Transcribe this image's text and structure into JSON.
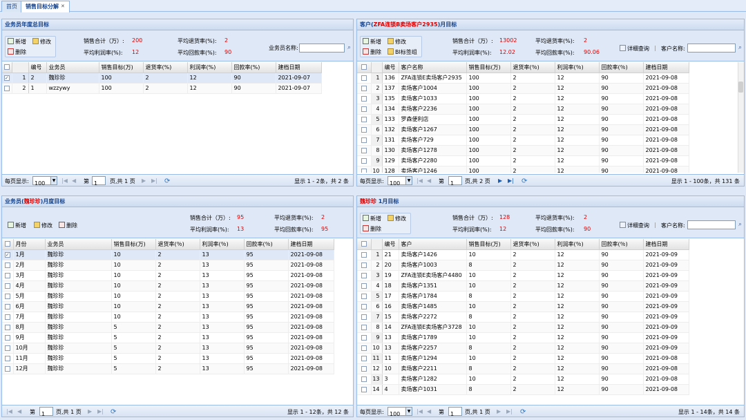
{
  "tabs": [
    {
      "label": "首页"
    },
    {
      "label": "销售目标分解"
    }
  ],
  "p1": {
    "title": "业务员年度总目标",
    "buttons": {
      "add": "新增",
      "edit": "修改",
      "del": "删除"
    },
    "stats": {
      "sales_label": "销售合计（万）:",
      "sales": "200",
      "return_label": "平均退货率(%):",
      "return": "2",
      "profit_label": "平均利润率(%):",
      "profit": "12",
      "collect_label": "平均回款率(%):",
      "collect": "90"
    },
    "search_label": "业务员名称:",
    "columns": [
      "",
      "",
      "编号",
      "业务员",
      "销售目标(万)",
      "退货率(%)",
      "利润率(%)",
      "回款率(%)",
      "建档日期"
    ],
    "rows": [
      [
        "1",
        "2",
        "魏珍珍",
        "100",
        "2",
        "12",
        "90",
        "2021-09-07"
      ],
      [
        "2",
        "1",
        "wzzywy",
        "100",
        "2",
        "12",
        "90",
        "2021-09-07"
      ]
    ],
    "pager": {
      "per_page_label": "每页显示:",
      "per_page": "100",
      "page_label": "第",
      "page": "1",
      "pages": "页,共 1 页",
      "info": "显示 1 - 2条，共 2 条"
    }
  },
  "p2": {
    "title_prefix": "客户(",
    "title_name": "ZFA连锁B卖场客户2935",
    "title_suffix": ")月目标",
    "buttons": {
      "add": "新增",
      "edit": "修改",
      "del": "删除",
      "bi": "BI标签组"
    },
    "stats": {
      "sales_label": "销售合计（万）:",
      "sales": "13002",
      "return_label": "平均退货率(%):",
      "return": "2",
      "profit_label": "平均利润率(%):",
      "profit": "12.02",
      "collect_label": "平均回款率(%):",
      "collect": "90.06"
    },
    "detail": "详细查询",
    "search_label": "客户名称:",
    "columns": [
      "",
      "",
      "编号",
      "客户名称",
      "销售目标(万)",
      "退货率(％)",
      "利润率(％)",
      "回款率(％)",
      "建档日期"
    ],
    "rows": [
      [
        "1",
        "136",
        "ZFA连锁E卖场客户2935",
        "100",
        "2",
        "12",
        "90",
        "2021-09-08"
      ],
      [
        "2",
        "137",
        "卖场客户1004",
        "100",
        "2",
        "12",
        "90",
        "2021-09-08"
      ],
      [
        "3",
        "135",
        "卖场客户1033",
        "100",
        "2",
        "12",
        "90",
        "2021-09-08"
      ],
      [
        "4",
        "134",
        "卖场客户2236",
        "100",
        "2",
        "12",
        "90",
        "2021-09-08"
      ],
      [
        "5",
        "133",
        "罗森便利店",
        "100",
        "2",
        "12",
        "90",
        "2021-09-08"
      ],
      [
        "6",
        "132",
        "卖场客户1267",
        "100",
        "2",
        "12",
        "90",
        "2021-09-08"
      ],
      [
        "7",
        "131",
        "卖场客户729",
        "100",
        "2",
        "12",
        "90",
        "2021-09-08"
      ],
      [
        "8",
        "130",
        "卖场客户1278",
        "100",
        "2",
        "12",
        "90",
        "2021-09-08"
      ],
      [
        "9",
        "129",
        "卖场客户2280",
        "100",
        "2",
        "12",
        "90",
        "2021-09-08"
      ],
      [
        "10",
        "128",
        "卖场客户1246",
        "100",
        "2",
        "12",
        "90",
        "2021-09-08"
      ]
    ],
    "pager": {
      "per_page_label": "每页显示:",
      "per_page": "100",
      "page_label": "第",
      "page": "1",
      "pages": "页,共 2 页",
      "info": "显示 1 - 100条，共 131 条"
    }
  },
  "p3": {
    "title_prefix": "业务员(",
    "title_name": "魏珍珍",
    "title_suffix": ")月度目标",
    "buttons": {
      "add": "新增",
      "edit": "修改",
      "del": "删除"
    },
    "stats": {
      "sales_label": "销售合计（万）:",
      "sales": "95",
      "return_label": "平均退货率(%):",
      "return": "2",
      "profit_label": "平均利润率(%):",
      "profit": "13",
      "collect_label": "平均回款率(%):",
      "collect": "95"
    },
    "columns": [
      "",
      "月份",
      "业务员",
      "销售目标(万)",
      "退货率(％)",
      "利润率(％)",
      "回款率(％)",
      "建档日期"
    ],
    "rows": [
      [
        "1月",
        "魏珍珍",
        "10",
        "2",
        "13",
        "95",
        "2021-09-08"
      ],
      [
        "2月",
        "魏珍珍",
        "10",
        "2",
        "13",
        "95",
        "2021-09-08"
      ],
      [
        "3月",
        "魏珍珍",
        "10",
        "2",
        "13",
        "95",
        "2021-09-08"
      ],
      [
        "4月",
        "魏珍珍",
        "10",
        "2",
        "13",
        "95",
        "2021-09-08"
      ],
      [
        "5月",
        "魏珍珍",
        "10",
        "2",
        "13",
        "95",
        "2021-09-08"
      ],
      [
        "6月",
        "魏珍珍",
        "10",
        "2",
        "13",
        "95",
        "2021-09-08"
      ],
      [
        "7月",
        "魏珍珍",
        "10",
        "2",
        "13",
        "95",
        "2021-09-08"
      ],
      [
        "8月",
        "魏珍珍",
        "5",
        "2",
        "13",
        "95",
        "2021-09-08"
      ],
      [
        "9月",
        "魏珍珍",
        "5",
        "2",
        "13",
        "95",
        "2021-09-08"
      ],
      [
        "10月",
        "魏珍珍",
        "5",
        "2",
        "13",
        "95",
        "2021-09-08"
      ],
      [
        "11月",
        "魏珍珍",
        "5",
        "2",
        "13",
        "95",
        "2021-09-08"
      ],
      [
        "12月",
        "魏珍珍",
        "5",
        "2",
        "13",
        "95",
        "2021-09-08"
      ]
    ],
    "pager": {
      "page_label": "第",
      "page": "1",
      "pages": "页,共 1 页",
      "info": "显示 1 - 12条，共 12 条"
    }
  },
  "p4": {
    "title_name": "魏珍珍",
    "title_suffix": " 1月目标",
    "buttons": {
      "add": "新增",
      "edit": "修改",
      "del": "删除"
    },
    "stats": {
      "sales_label": "销售合计（万）:",
      "sales": "128",
      "return_label": "平均退货率(%):",
      "return": "2",
      "profit_label": "平均利润率(%):",
      "profit": "12",
      "collect_label": "平均回款率(%):",
      "collect": "90"
    },
    "detail": "详细查询",
    "search_label": "客户名称:",
    "columns": [
      "",
      "",
      "编号",
      "客户",
      "销售目标(万)",
      "退货率(％)",
      "利润率(％)",
      "回款率(％)",
      "建档日期"
    ],
    "rows": [
      [
        "1",
        "21",
        "卖场客户1426",
        "10",
        "2",
        "12",
        "90",
        "2021-09-09"
      ],
      [
        "2",
        "20",
        "卖场客户1003",
        "8",
        "2",
        "12",
        "90",
        "2021-09-09"
      ],
      [
        "3",
        "19",
        "ZFA连锁E卖场客户4480",
        "10",
        "2",
        "12",
        "90",
        "2021-09-09"
      ],
      [
        "4",
        "18",
        "卖场客户1351",
        "10",
        "2",
        "12",
        "90",
        "2021-09-09"
      ],
      [
        "5",
        "17",
        "卖场客户1784",
        "8",
        "2",
        "12",
        "90",
        "2021-09-09"
      ],
      [
        "6",
        "16",
        "卖场客户1485",
        "10",
        "2",
        "12",
        "90",
        "2021-09-09"
      ],
      [
        "7",
        "15",
        "卖场客户2272",
        "8",
        "2",
        "12",
        "90",
        "2021-09-09"
      ],
      [
        "8",
        "14",
        "ZFA连锁E卖场客户3728",
        "10",
        "2",
        "12",
        "90",
        "2021-09-09"
      ],
      [
        "9",
        "13",
        "卖场客户1789",
        "10",
        "2",
        "12",
        "90",
        "2021-09-09"
      ],
      [
        "10",
        "13",
        "卖场客户2257",
        "8",
        "2",
        "12",
        "90",
        "2021-09-09"
      ],
      [
        "11",
        "11",
        "卖场客户1294",
        "10",
        "2",
        "12",
        "90",
        "2021-09-08"
      ],
      [
        "12",
        "10",
        "卖场客户2211",
        "8",
        "2",
        "12",
        "90",
        "2021-09-08"
      ],
      [
        "13",
        "3",
        "卖场客户1282",
        "10",
        "2",
        "12",
        "90",
        "2021-09-08"
      ],
      [
        "14",
        "4",
        "卖场客户1031",
        "8",
        "2",
        "12",
        "90",
        "2021-09-08"
      ]
    ],
    "pager": {
      "per_page_label": "每页显示:",
      "per_page": "100",
      "page_label": "第",
      "page": "1",
      "pages": "页,共 1 页",
      "info": "显示 1 - 14条，共 14 条"
    }
  }
}
